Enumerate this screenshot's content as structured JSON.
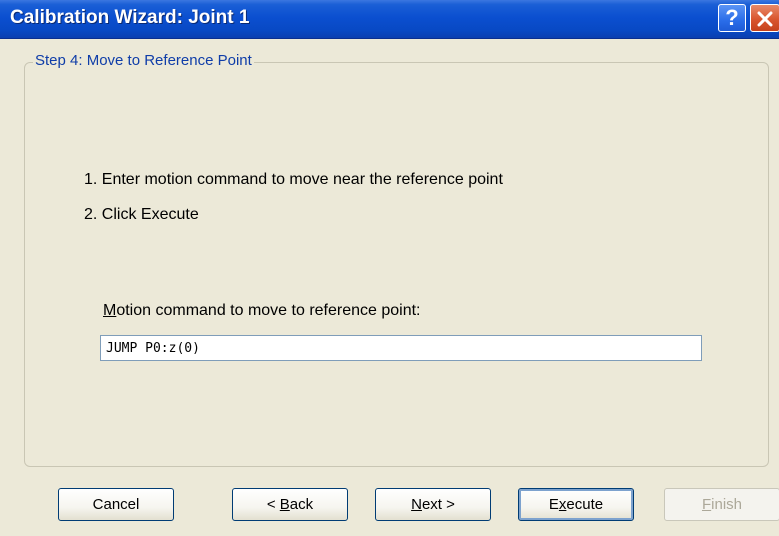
{
  "window": {
    "title": "Calibration Wizard: Joint 1",
    "help_glyph": "?",
    "close_icon": "close-icon"
  },
  "step": {
    "title": "Step 4: Move to Reference Point"
  },
  "instructions": [
    "1. Enter motion command to move near the reference point",
    "2. Click Execute"
  ],
  "motion_field": {
    "label_mnemonic": "M",
    "label_rest": "otion command to move to reference point:",
    "value": "JUMP P0:z(0)"
  },
  "buttons": {
    "cancel": "Cancel",
    "back_prefix": "< ",
    "back_mnemonic": "B",
    "back_rest": "ack",
    "next_mnemonic": "N",
    "next_rest": "ext >",
    "execute_first": "E",
    "execute_mnemonic": "x",
    "execute_rest": "ecute",
    "finish_mnemonic": "F",
    "finish_rest": "inish"
  },
  "colors": {
    "titlebar": "#0b4fd0",
    "dialog_bg": "#ece9d8",
    "group_title": "#0f3da8",
    "button_border": "#003c74",
    "close_button": "#d9562f",
    "disabled_text": "#aca899"
  }
}
